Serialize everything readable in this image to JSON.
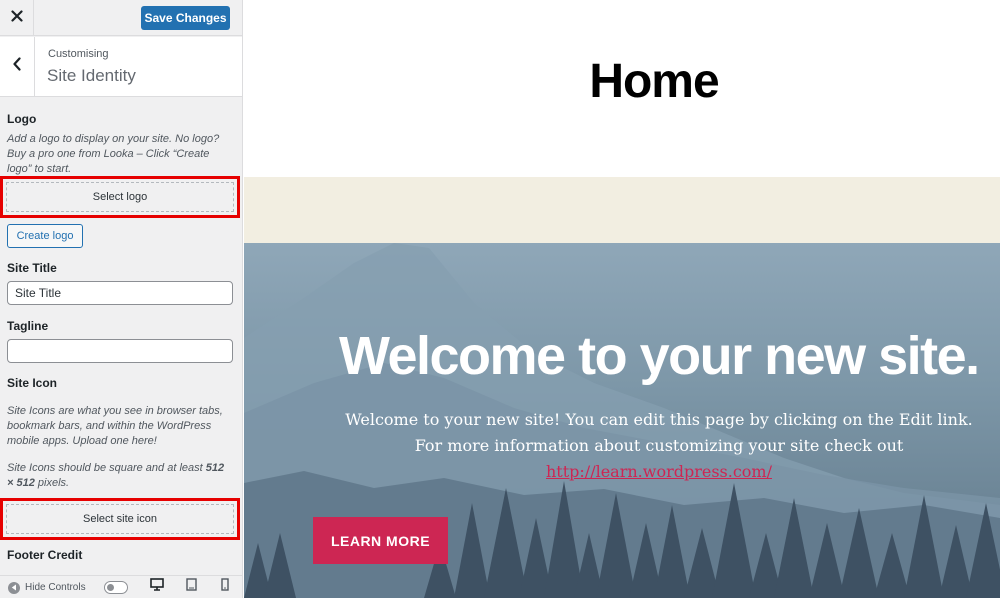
{
  "topbar": {
    "close_icon": "close-icon",
    "save_label": "Save Changes",
    "save_color": "#2271b1"
  },
  "section": {
    "breadcrumb": "Customising",
    "title": "Site Identity",
    "back_icon": "chevron-left-icon"
  },
  "logo": {
    "label": "Logo",
    "description": "Add a logo to display on your site. No logo? Buy a pro one from Looka – Click “Create logo” to start.",
    "select_label": "Select logo",
    "create_label": "Create logo"
  },
  "site_title": {
    "label": "Site Title",
    "value": "Site Title"
  },
  "tagline": {
    "label": "Tagline",
    "value": ""
  },
  "site_icon": {
    "label": "Site Icon",
    "description": "Site Icons are what you see in browser tabs, bookmark bars, and within the WordPress mobile apps. Upload one here!",
    "note_prefix": "Site Icons should be square and at least ",
    "note_size": "512 × 512",
    "note_suffix": " pixels.",
    "select_label": "Select site icon"
  },
  "footer_credit": {
    "label": "Footer Credit"
  },
  "footer": {
    "hide_label": "Hide Controls",
    "devices": [
      "desktop-icon",
      "tablet-icon",
      "mobile-icon"
    ]
  },
  "preview": {
    "page_title": "Home",
    "hero_title": "Welcome to your new site.",
    "hero_text": "Welcome to your new site! You can edit this page by clicking on the Edit link. For more information about customizing your site check out ",
    "hero_link": "http://learn.wordpress.com/",
    "button_label": "LEARN MORE",
    "accent_color": "#cd2653",
    "band_color": "#f2eee1"
  },
  "highlight_color": "#e60000"
}
